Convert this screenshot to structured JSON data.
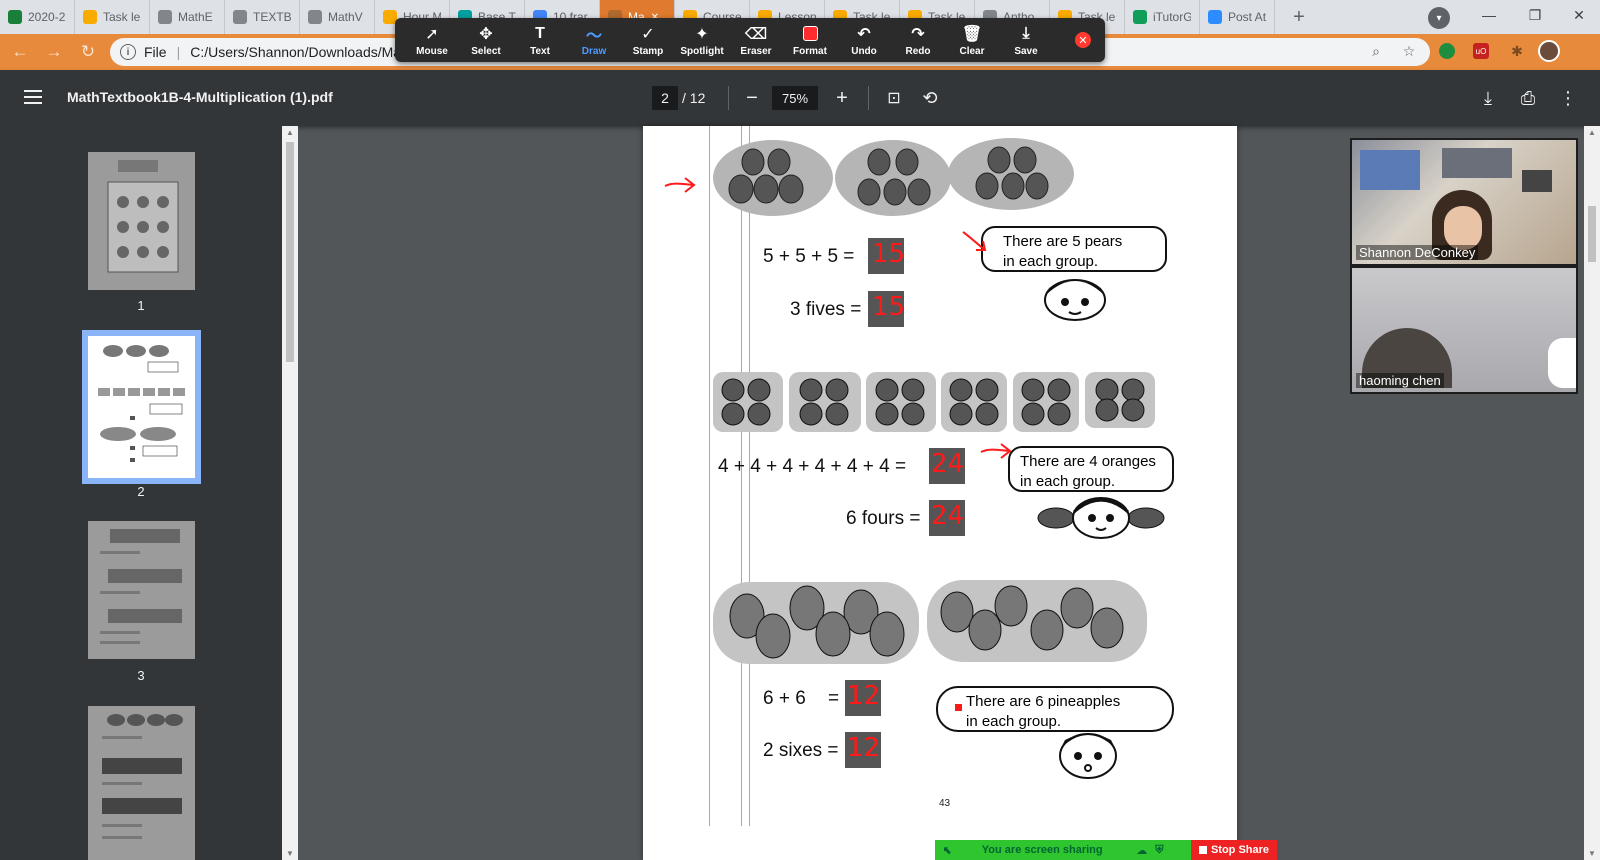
{
  "browser": {
    "tabs": [
      {
        "label": "2020-2",
        "fav": "sheets-icon",
        "color": "#188038"
      },
      {
        "label": "Task le",
        "fav": "doc-icon",
        "color": "#f9ab00"
      },
      {
        "label": "MathE",
        "fav": "globe-icon",
        "color": "#80868b"
      },
      {
        "label": "TEXTB",
        "fav": "globe-icon",
        "color": "#80868b"
      },
      {
        "label": "MathV",
        "fav": "globe-icon",
        "color": "#80868b"
      },
      {
        "label": "Hour M",
        "fav": "doc-icon",
        "color": "#f9ab00"
      },
      {
        "label": "Base T",
        "fav": "globe-icon",
        "color": "#00a0a0"
      },
      {
        "label": "10 frar",
        "fav": "docs-icon",
        "color": "#4285f4"
      },
      {
        "label": "Ma",
        "fav": "globe-icon",
        "color": "#b06a2e",
        "active": true
      },
      {
        "label": "Course",
        "fav": "doc-icon",
        "color": "#f9ab00"
      },
      {
        "label": "Lesson",
        "fav": "doc-icon",
        "color": "#f9ab00"
      },
      {
        "label": "Task le",
        "fav": "doc-icon",
        "color": "#f9ab00"
      },
      {
        "label": "Task le",
        "fav": "doc-icon",
        "color": "#f9ab00"
      },
      {
        "label": "Antho",
        "fav": "globe-icon",
        "color": "#80868b"
      },
      {
        "label": "Task le",
        "fav": "doc-icon",
        "color": "#f9ab00"
      },
      {
        "label": "iTutorG",
        "fav": "doc-icon",
        "color": "#0f9d58"
      },
      {
        "label": "Post At",
        "fav": "zoom-icon",
        "color": "#2d8cff"
      }
    ],
    "new_tab": "+",
    "address_scheme": "File",
    "address": "C:/Users/Shannon/Downloads/Mat"
  },
  "annotate_toolbar": {
    "tools": [
      {
        "label": "Mouse",
        "glyph": "➚",
        "icon": "mouse-pointer-icon"
      },
      {
        "label": "Select",
        "glyph": "✥",
        "icon": "select-move-icon"
      },
      {
        "label": "Text",
        "glyph": "T",
        "icon": "text-icon"
      },
      {
        "label": "Draw",
        "glyph": "〜",
        "icon": "draw-icon",
        "selected": true
      },
      {
        "label": "Stamp",
        "glyph": "✓",
        "icon": "stamp-icon"
      },
      {
        "label": "Spotlight",
        "glyph": "✦",
        "icon": "spotlight-icon"
      },
      {
        "label": "Eraser",
        "glyph": "⌫",
        "icon": "eraser-icon"
      },
      {
        "label": "Format",
        "glyph": "",
        "icon": "format-color-icon"
      },
      {
        "label": "Undo",
        "glyph": "↶",
        "icon": "undo-icon"
      },
      {
        "label": "Redo",
        "glyph": "↷",
        "icon": "redo-icon"
      },
      {
        "label": "Clear",
        "glyph": "🗑",
        "icon": "trash-icon"
      },
      {
        "label": "Save",
        "glyph": "⤓",
        "icon": "save-icon"
      }
    ],
    "close": "✕"
  },
  "pdf_viewer": {
    "title": "MathTextbook1B-4-Multiplication (1).pdf",
    "current_page": "2",
    "total_pages": "/ 12",
    "zoom": "75%",
    "zoom_out": "−",
    "zoom_in": "+",
    "thumbnail_labels": [
      "1",
      "2",
      "3"
    ]
  },
  "page_content": {
    "eq1": "5 + 5 + 5 =",
    "eq1_answer": "15",
    "eq2": "3 fives =",
    "eq2_answer": "15",
    "bubble1_line1": "There are 5 pears",
    "bubble1_line2": "in each group.",
    "eq3": "4 + 4 + 4 + 4 + 4 + 4 =",
    "eq3_answer": "24",
    "eq4": "6 fours =",
    "eq4_answer": "24",
    "bubble2_line1": "There are 4 oranges",
    "bubble2_line2": "in each group.",
    "eq5": "6 + 6",
    "eq5_equals": "=",
    "eq5_answer": "12",
    "eq6": "2 sixes =",
    "eq6_answer": "12",
    "bubble3_line1": "There are 6 pineapples",
    "bubble3_line2": "in each group.",
    "page_number": "43"
  },
  "video": {
    "participants": [
      "Shannon DeConkey",
      "haoming chen"
    ]
  },
  "share_bar": {
    "status": "You are screen sharing",
    "stop": "Stop Share"
  },
  "colors": {
    "tab_active": "#e07a2e",
    "omnibar": "#e88a3c",
    "annotation_red": "#ff1a1a",
    "share_green": "#2ec52e",
    "stop_red": "#ee2222"
  }
}
